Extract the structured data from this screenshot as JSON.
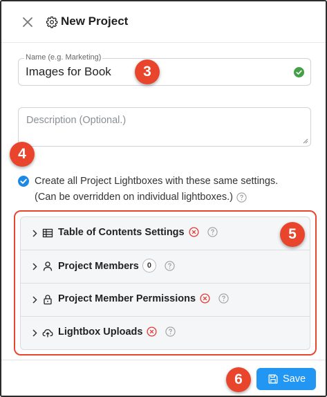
{
  "dialog": {
    "title": "New Project",
    "icons": {
      "close": "close-icon",
      "settings": "gear-icon"
    }
  },
  "name_field": {
    "label": "Name (e.g. Marketing)",
    "value": "Images for Book",
    "status_icon": "valid-check-icon"
  },
  "description_field": {
    "placeholder": "Description (Optional.)",
    "value": ""
  },
  "checkbox": {
    "checked": true,
    "label": "Create all Project Lightboxes with these same settings. (Can be overridden on individual lightboxes.)"
  },
  "sections": [
    {
      "label": "Table of Contents Settings",
      "icon": "table-icon",
      "status_icon": "error-icon",
      "help_icon": "help-icon"
    },
    {
      "label": "Project Members",
      "icon": "user-icon",
      "count": "0",
      "help_icon": "help-icon"
    },
    {
      "label": "Project Member Permissions",
      "icon": "lock-icon",
      "status_icon": "error-icon",
      "help_icon": "help-icon"
    },
    {
      "label": "Lightbox Uploads",
      "icon": "cloud-upload-icon",
      "status_icon": "error-icon",
      "help_icon": "help-icon"
    }
  ],
  "annotations": [
    "3",
    "4",
    "5",
    "6"
  ],
  "footer": {
    "save_label": "Save",
    "save_icon": "floppy-disk-icon"
  },
  "colors": {
    "primary": "#2196f3",
    "error": "#e53935",
    "success": "#43a047",
    "annotation": "#e8452c"
  }
}
